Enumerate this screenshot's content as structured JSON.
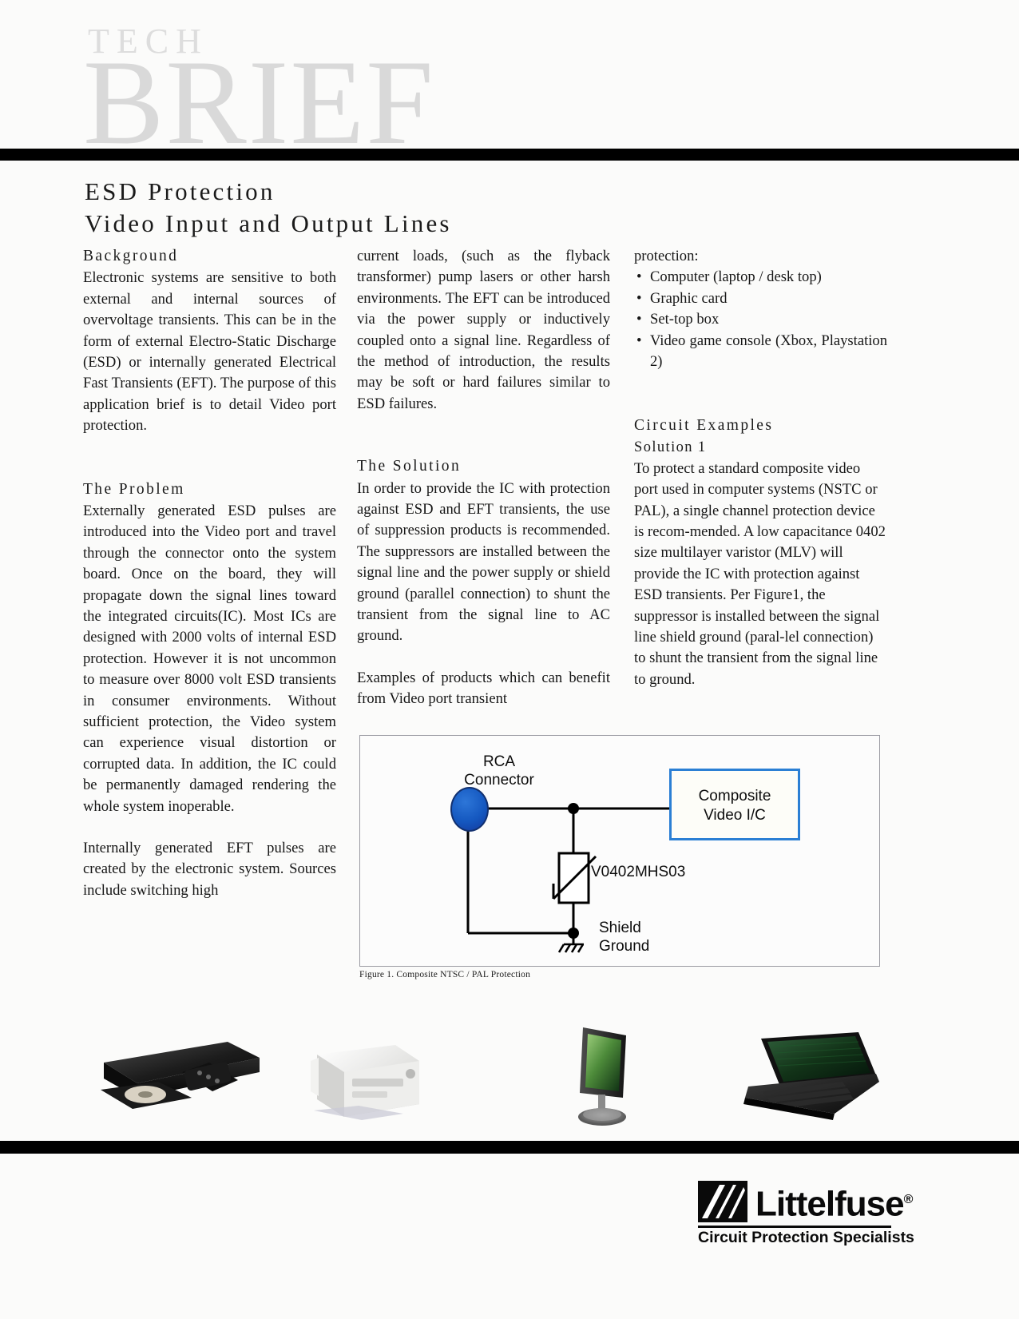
{
  "masthead": {
    "kicker": "TECH",
    "wordmark": "BRIEF"
  },
  "title": {
    "line1": "ESD Protection",
    "line2": "Video Input and Output Lines"
  },
  "columns": {
    "col1": {
      "background_heading": "Background",
      "background_body": "Electronic systems are sensitive to both external and internal sources of overvoltage transients.   This can be in the form of external Electro-Static Discharge (ESD) or internally generated Electrical Fast Transients (EFT). The purpose of this application brief is to detail Video port protection.",
      "problem_heading": "The Problem",
      "problem_body_1": "Externally generated ESD pulses are introduced into the Video port and travel through the connector onto the system board.  Once on the board, they will propagate down the signal lines toward the integrated circuits(IC).  Most ICs are designed with 2000 volts of internal ESD protection.    However it is not uncommon to measure over 8000 volt ESD transients in consumer environments. Without sufficient protection, the Video system can experience visual distortion or corrupted data. In addition, the IC could be permanently damaged rendering the whole system inoperable.",
      "problem_body_2": "Internally generated EFT pulses are created by the electronic system. Sources include switching high"
    },
    "col2": {
      "continued_body": "current loads, (such as the flyback transformer) pump lasers or other harsh environments. The EFT can be introduced via the power supply or inductively coupled onto a signal line.  Regardless of the method of introduction, the results may be soft or hard failures similar to ESD failures.",
      "solution_heading": "The Solution",
      "solution_body_1": "In order to provide the IC with protection against ESD and EFT transients, the use of suppression products is recommended.   The suppressors are installed between the signal line and the power supply or shield ground (parallel connection) to shunt the transient from the signal line to AC ground.",
      "solution_body_2": "Examples of products which can benefit from Video port transient"
    },
    "col3": {
      "protection_lead": "protection:",
      "bullets": [
        "Computer (laptop / desk top)",
        "Graphic card",
        "Set-top box",
        "Video game console (Xbox, Playstation 2)"
      ],
      "bullet_glyph": "•",
      "examples_heading": "Circuit Examples",
      "solution1_heading": "Solution 1",
      "solution1_body": "To protect a standard composite video port used in computer systems (NSTC or PAL), a single channel protection device is recom-mended. A low capacitance 0402 size multilayer varistor (MLV) will provide the IC with protection against ESD transients. Per Figure1, the suppressor is installed between the signal line shield ground (paral-lel connection) to shunt the transient from the signal  line to ground."
    }
  },
  "figure": {
    "caption": "Figure 1. Composite  NTSC / PAL Protection",
    "rca_label_line1": "RCA",
    "rca_label_line2": "Connector",
    "ic_label_line1": "Composite",
    "ic_label_line2": "Video I/C",
    "part_number": "V0402MHS03",
    "ground_label_line1": "Shield",
    "ground_label_line2": "Ground",
    "colors": {
      "ic_border": "#2b7fd4",
      "connector": "#1558c0",
      "wire": "#000000"
    }
  },
  "photos": [
    {
      "name": "dvd-player"
    },
    {
      "name": "projector"
    },
    {
      "name": "flat-panel-monitor"
    },
    {
      "name": "laptop-computer"
    }
  ],
  "footer": {
    "brand": "Littelfuse",
    "registered": "®",
    "tagline": "Circuit Protection Specialists"
  }
}
